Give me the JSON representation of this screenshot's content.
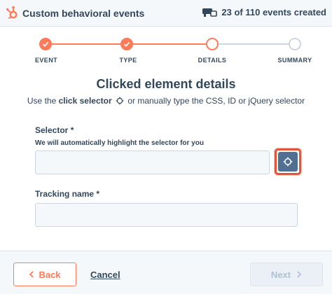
{
  "header": {
    "title": "Custom behavioral events",
    "logo_icon": "hubspot-sprocket-icon",
    "counter_icon": "events-icon",
    "counter_text": "23 of 110 events created"
  },
  "stepper": {
    "accent_color": "#ff7a59",
    "pending_color": "#cbd6e2",
    "steps": [
      {
        "label": "EVENT",
        "state": "done"
      },
      {
        "label": "TYPE",
        "state": "done"
      },
      {
        "label": "DETAILS",
        "state": "current"
      },
      {
        "label": "SUMMARY",
        "state": "pending"
      }
    ]
  },
  "main": {
    "title": "Clicked element details",
    "subtitle_before": "Use the ",
    "subtitle_bold": "click selector",
    "subtitle_after": " or manually type the CSS, ID or jQuery selector"
  },
  "selector_field": {
    "label": "Selector *",
    "help": "We will automatically highlight the selector for you",
    "value": "",
    "placeholder": "",
    "button_icon": "crosshair-target-icon"
  },
  "tracking_field": {
    "label": "Tracking name *",
    "value": "",
    "placeholder": ""
  },
  "footer": {
    "back_label": "Back",
    "cancel_label": "Cancel",
    "next_label": "Next"
  }
}
